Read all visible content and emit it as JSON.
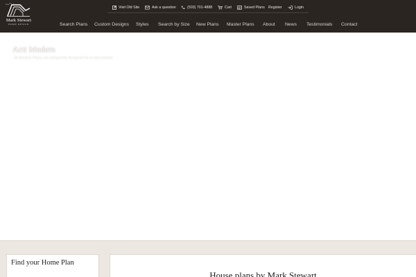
{
  "brand": {
    "name": "Mark Stewart",
    "subtitle": "HOME DESIGN"
  },
  "utility_nav": [
    {
      "label": "Visit Old Site",
      "icon": "external-link-icon"
    },
    {
      "label": "Ask a question",
      "icon": "envelope-icon"
    },
    {
      "label": "(503) 701-4888",
      "icon": "phone-icon"
    },
    {
      "label": "Cart",
      "icon": "cart-icon"
    },
    {
      "label": "Saved Plans",
      "icon": "saved-plans-icon"
    },
    {
      "label": "Register",
      "icon": ""
    },
    {
      "label": "Login",
      "icon": "login-icon"
    }
  ],
  "main_nav": [
    "Search Plans",
    "Custom Designs",
    "Styles",
    "Search by Size",
    "New Plans",
    "Master Plans",
    "About",
    "News",
    "Testimonials",
    "Contact"
  ],
  "hero": {
    "title": "Acti Modern",
    "subtitle": "All Modern Plans are completely designed for a new market"
  },
  "sidebar": {
    "title": "Find your Home Plan"
  },
  "content": {
    "title": "House plans by Mark Stewart"
  },
  "colors": {
    "header_bg": "#2b2522",
    "band_bg": "#ece8e1",
    "nav_text": "#d9d3cd"
  }
}
